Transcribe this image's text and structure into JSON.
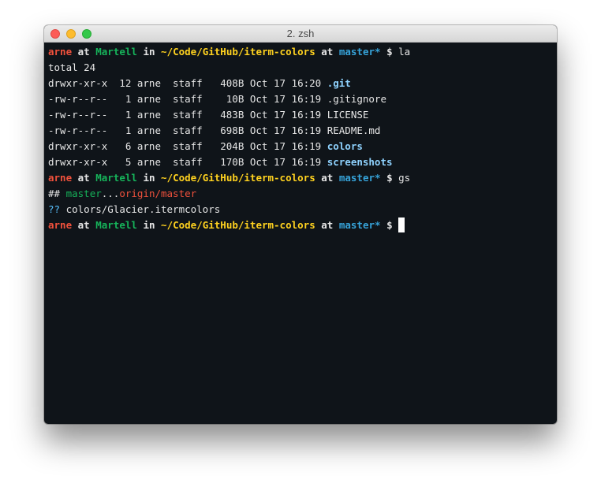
{
  "window": {
    "title": "2. zsh"
  },
  "prompt": {
    "user": "arne",
    "at": "at",
    "host": "Martell",
    "in": "in",
    "path": "~/Code/GitHub/iterm-colors",
    "at2": "at",
    "branch": "master*",
    "symbol": "$"
  },
  "commands": {
    "first": "la",
    "second": "gs"
  },
  "listing": {
    "total": "total 24",
    "rows": [
      {
        "perms": "drwxr-xr-x",
        "links": "12",
        "owner": "arne",
        "group": "staff",
        "size": "408B",
        "month": "Oct",
        "day": "17",
        "time": "16:20",
        "name": ".git",
        "is_dir": true
      },
      {
        "perms": "-rw-r--r--",
        "links": "1",
        "owner": "arne",
        "group": "staff",
        "size": "10B",
        "month": "Oct",
        "day": "17",
        "time": "16:19",
        "name": ".gitignore",
        "is_dir": false
      },
      {
        "perms": "-rw-r--r--",
        "links": "1",
        "owner": "arne",
        "group": "staff",
        "size": "483B",
        "month": "Oct",
        "day": "17",
        "time": "16:19",
        "name": "LICENSE",
        "is_dir": false
      },
      {
        "perms": "-rw-r--r--",
        "links": "1",
        "owner": "arne",
        "group": "staff",
        "size": "698B",
        "month": "Oct",
        "day": "17",
        "time": "16:19",
        "name": "README.md",
        "is_dir": false
      },
      {
        "perms": "drwxr-xr-x",
        "links": "6",
        "owner": "arne",
        "group": "staff",
        "size": "204B",
        "month": "Oct",
        "day": "17",
        "time": "16:19",
        "name": "colors",
        "is_dir": true
      },
      {
        "perms": "drwxr-xr-x",
        "links": "5",
        "owner": "arne",
        "group": "staff",
        "size": "170B",
        "month": "Oct",
        "day": "17",
        "time": "16:19",
        "name": "screenshots",
        "is_dir": true
      }
    ]
  },
  "git_status": {
    "header_prefix": "##",
    "local_branch": "master",
    "separator": "...",
    "remote_branch": "origin/master",
    "untracked_marker": "??",
    "untracked_file": "colors/Glacier.itermcolors"
  },
  "colors": {
    "background": "#0f1419",
    "user": "#f0513c",
    "host": "#16b35a",
    "path": "#ffd21f",
    "branch": "#36a3d9",
    "directory": "#8fd3ff"
  }
}
